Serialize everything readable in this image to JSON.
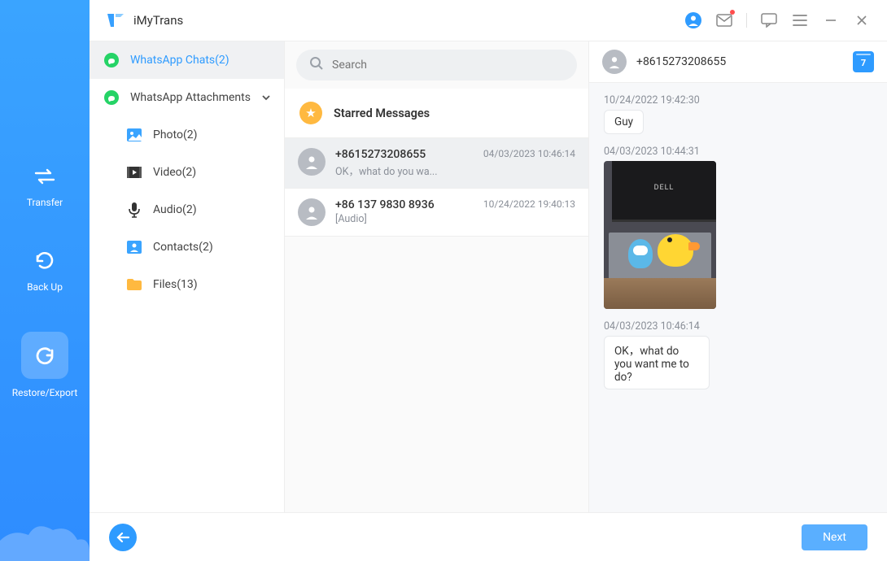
{
  "app_title": "iMyTrans",
  "nav": {
    "transfer": "Transfer",
    "backup": "Back Up",
    "restore": "Restore/Export"
  },
  "categories": {
    "chats": "WhatsApp Chats(2)",
    "attachments": "WhatsApp Attachments",
    "photo": "Photo(2)",
    "video": "Video(2)",
    "audio": "Audio(2)",
    "contacts": "Contacts(2)",
    "files": "Files(13)"
  },
  "search": {
    "placeholder": "Search"
  },
  "starred_label": "Starred Messages",
  "chats": [
    {
      "name": "+8615273208655",
      "preview": "OK，what do you wa...",
      "time": "04/03/2023 10:46:14"
    },
    {
      "name": "+86 137 9830 8936",
      "preview": "[Audio]",
      "time": "10/24/2022 19:40:13"
    }
  ],
  "conversation": {
    "title": "+8615273208655",
    "calendar_day": "7",
    "messages": [
      {
        "ts": "10/24/2022 19:42:30",
        "type": "text",
        "text": "Guy"
      },
      {
        "ts": "04/03/2023 10:44:31",
        "type": "image",
        "monitor_brand": "DELL"
      },
      {
        "ts": "04/03/2023 10:46:14",
        "type": "text",
        "text": "OK，what do you want me to do?"
      }
    ]
  },
  "footer": {
    "next": "Next"
  }
}
